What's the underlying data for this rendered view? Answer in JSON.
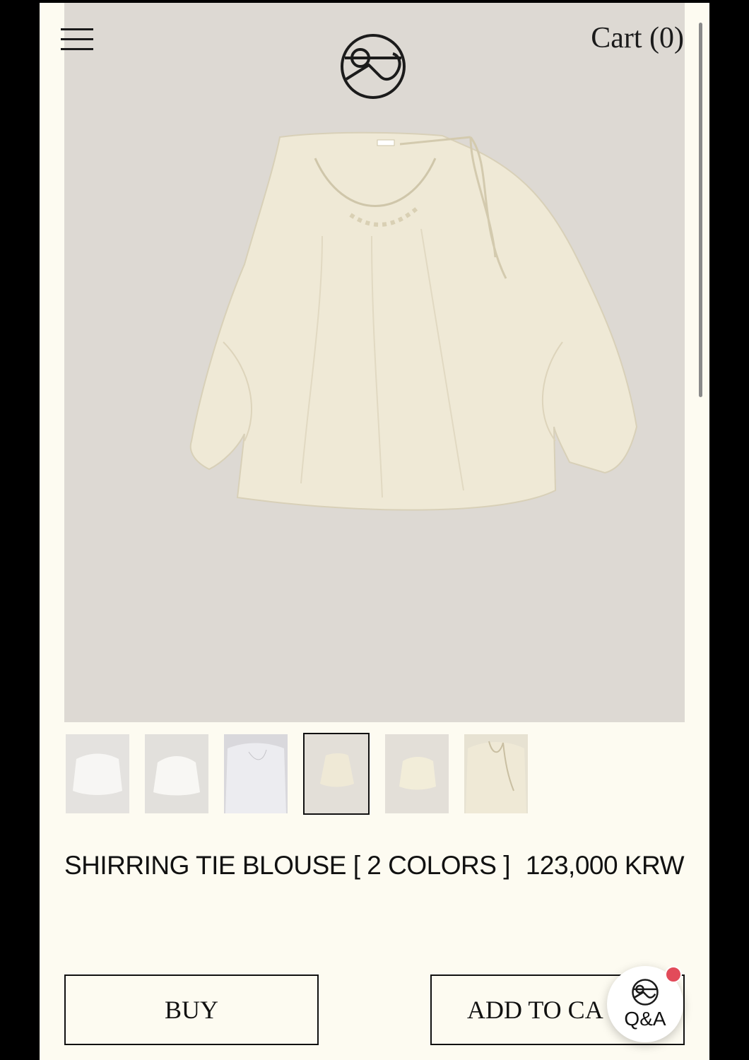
{
  "header": {
    "cart_label": "Cart (0)"
  },
  "icons": {
    "menu": "hamburger-menu-icon",
    "logo": "brand-logo-icon",
    "qa": "qa-chat-icon"
  },
  "gallery": {
    "thumbnail_count": 6,
    "selected_index": 3
  },
  "product": {
    "name": "SHIRRING TIE BLOUSE [ 2 COLORS ]",
    "price": "123,000 KRW"
  },
  "actions": {
    "buy_label": "BUY",
    "add_to_cart_label": "ADD TO CA"
  },
  "qa_widget": {
    "label": "Q&A"
  },
  "colors": {
    "page_bg": "#fdfbf1",
    "hero_bg": "#ddd9d3",
    "blouse": "#efe9d6",
    "badge": "#e24b5a"
  }
}
